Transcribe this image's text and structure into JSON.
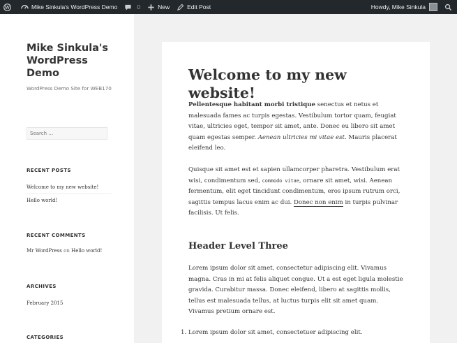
{
  "adminbar": {
    "site_name": "Mike Sinkula's WordPress Demo",
    "comments_count": "0",
    "new_label": "New",
    "edit_label": "Edit Post",
    "howdy": "Howdy, Mike Sinkula"
  },
  "sidebar": {
    "site_title": "Mike Sinkula's WordPress Demo",
    "site_description": "WordPress Demo Site for WEB170",
    "search_placeholder": "Search …",
    "recent_posts": {
      "title": "RECENT POSTS",
      "items": [
        "Welcome to my new website!",
        "Hello world!"
      ]
    },
    "recent_comments": {
      "title": "RECENT COMMENTS",
      "author": "Mr WordPress",
      "on": "on",
      "post": "Hello world!"
    },
    "archives": {
      "title": "ARCHIVES",
      "items": [
        "February 2015"
      ]
    },
    "categories": {
      "title": "CATEGORIES"
    }
  },
  "post": {
    "title": "Welcome to my new website!",
    "p1": {
      "bold": "Pellentesque habitant morbi tristique",
      "text1": " senectus et netus et malesuada fames ac turpis egestas. Vestibulum tortor quam, feugiat vitae, ultricies eget, tempor sit amet, ante. Donec eu libero sit amet quam egestas semper. ",
      "italic": "Aenean ultricies mi vitae est.",
      "text2": " Mauris placerat eleifend leo."
    },
    "p2": {
      "text1": "Quisque sit amet est et sapien ullamcorper pharetra. Vestibulum erat wisi, condimentum sed, ",
      "code": "commodo vitae",
      "text2": ", ornare sit amet, wisi. Aenean fermentum, elit eget tincidunt condimentum, eros ipsum rutrum orci, sagittis tempus lacus enim ac dui. ",
      "link": "Donec non enim",
      "text3": " in turpis pulvinar facilisis. Ut felis."
    },
    "h3": "Header Level Three",
    "p3": "Lorem ipsum dolor sit amet, consectetur adipiscing elit. Vivamus magna. Cras in mi at felis aliquet congue. Ut a est eget ligula molestie gravida. Curabitur massa. Donec eleifend, libero at sagittis mollis, tellus est malesuada tellus, at luctus turpis elit sit amet quam. Vivamus pretium ornare est.",
    "list": [
      {
        "num": "1.",
        "text": "Lorem ipsum dolor sit amet, consectetuer adipiscing elit."
      }
    ]
  }
}
